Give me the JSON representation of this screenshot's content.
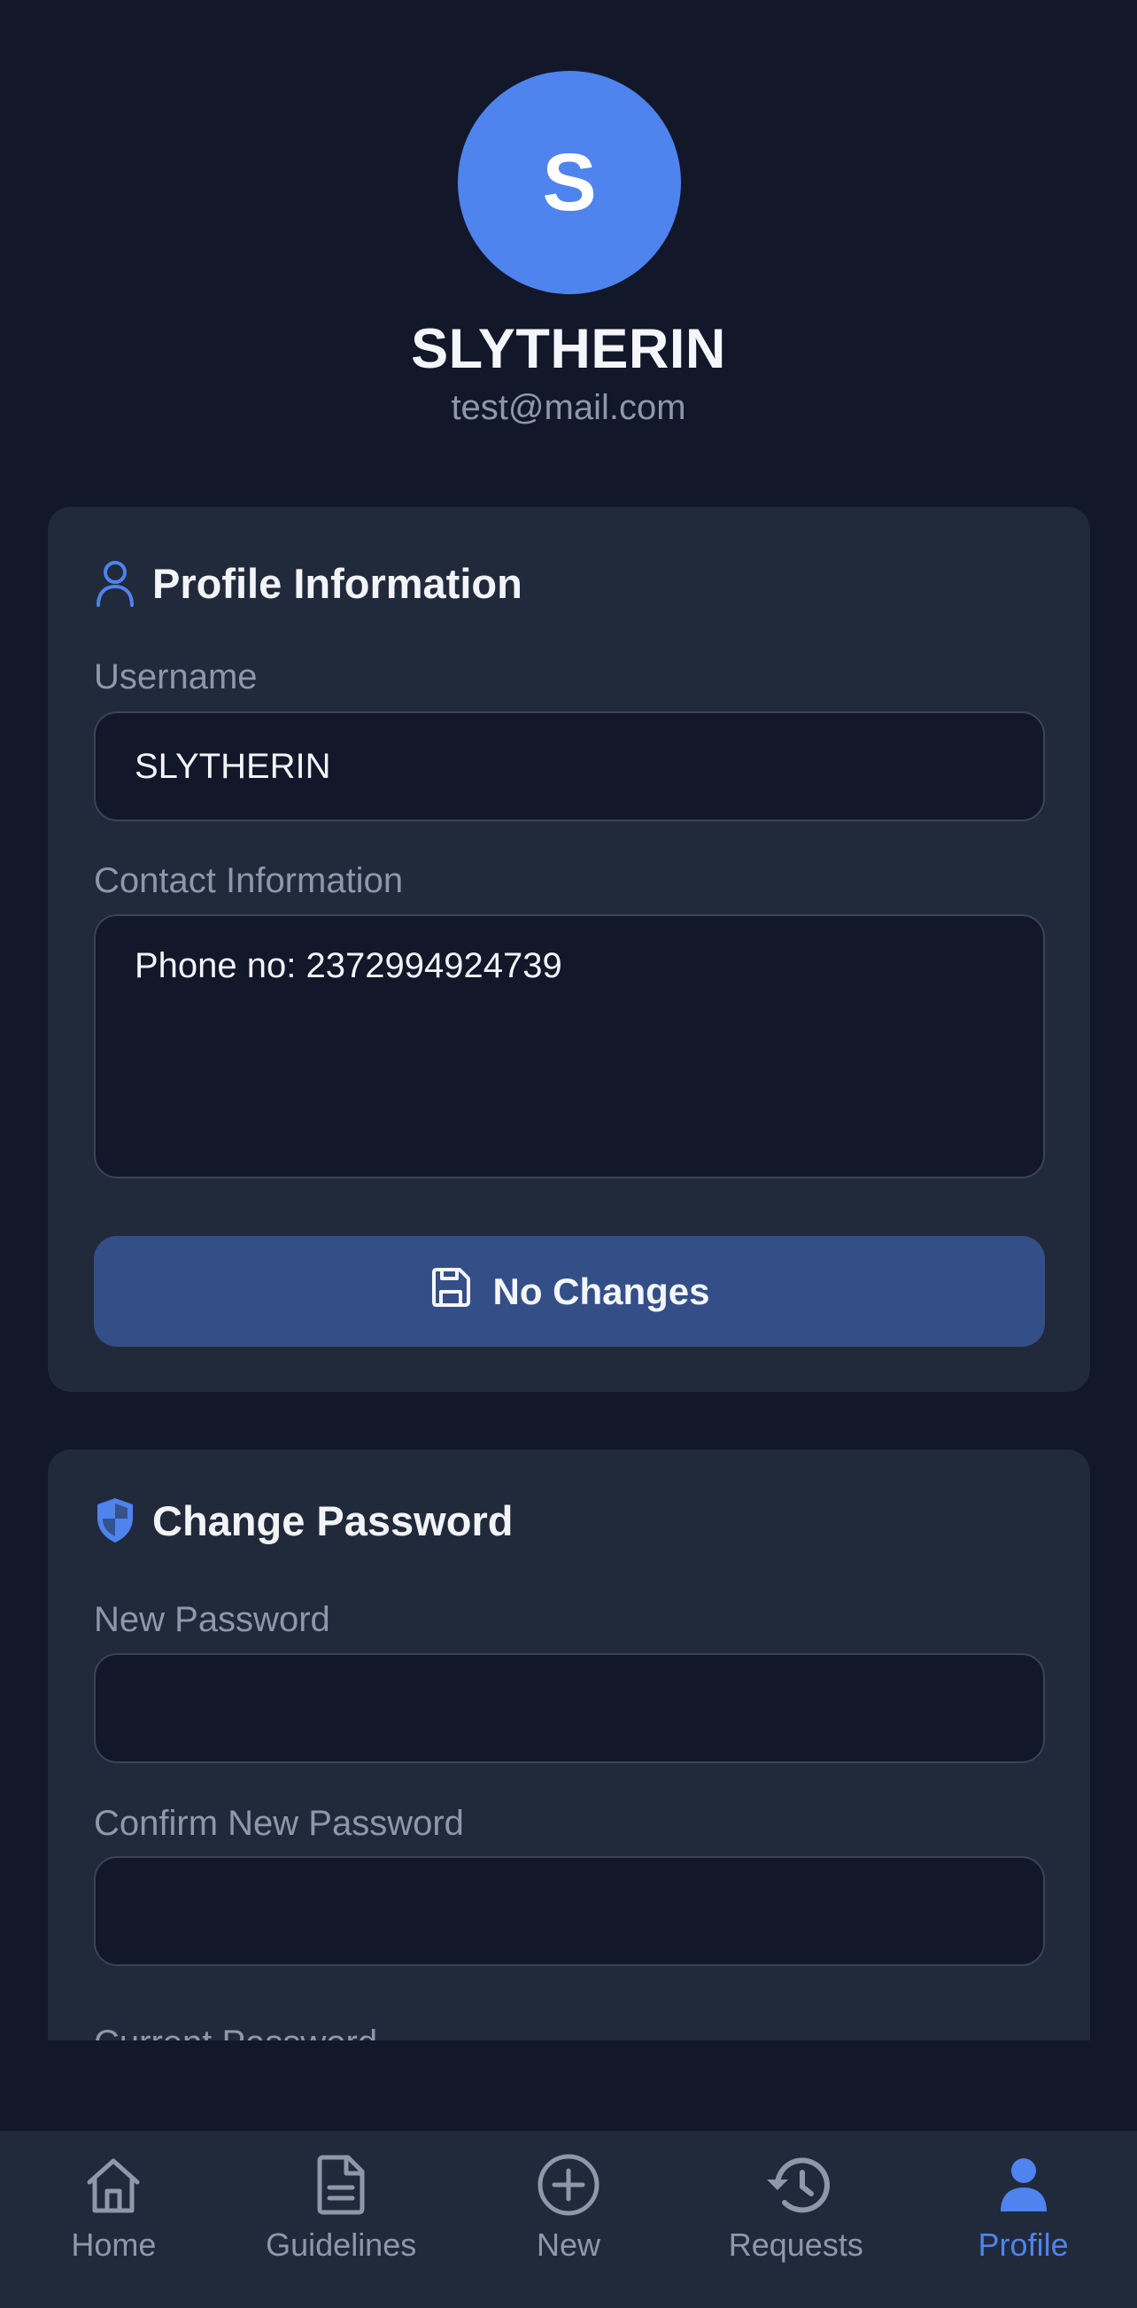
{
  "profile": {
    "avatar_initial": "S",
    "name": "SLYTHERIN",
    "email": "test@mail.com"
  },
  "profile_card": {
    "title": "Profile Information",
    "username_label": "Username",
    "username_value": "SLYTHERIN",
    "contact_label": "Contact Information",
    "contact_value": "Phone no: 2372994924739",
    "save_label": "No Changes"
  },
  "password_card": {
    "title": "Change Password",
    "new_password_label": "New Password",
    "confirm_password_label": "Confirm New Password",
    "current_password_label": "Current Password"
  },
  "nav": {
    "items": [
      {
        "label": "Home",
        "icon": "home-icon"
      },
      {
        "label": "Guidelines",
        "icon": "document-icon"
      },
      {
        "label": "New",
        "icon": "plus-circle-icon"
      },
      {
        "label": "Requests",
        "icon": "history-icon"
      },
      {
        "label": "Profile",
        "icon": "user-icon",
        "active": true
      }
    ]
  },
  "colors": {
    "background": "#121829",
    "card": "#212a3b",
    "accent": "#4f83ee",
    "button": "#344f88",
    "muted_text": "#8e98ab"
  }
}
